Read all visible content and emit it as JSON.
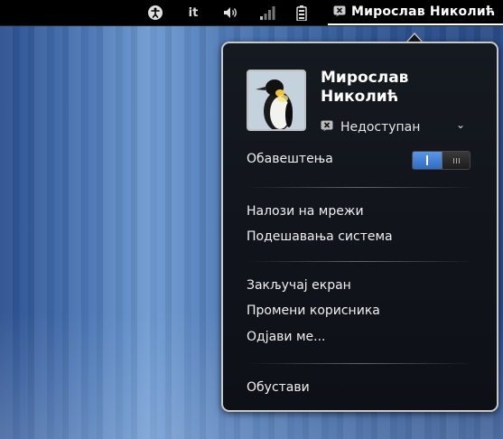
{
  "topbar": {
    "icons": [
      "accessibility-icon",
      "keyboard-layout-indicator",
      "volume-icon",
      "network-signal-icon",
      "battery-icon"
    ],
    "keyboard_layout": "it",
    "user_name": "Мирослав Николић",
    "status_icon": "unavailable-status-icon"
  },
  "menu": {
    "user_fullname": "Мирослав Николић",
    "status_label": "Недоступан",
    "notifications_label": "Обавештења",
    "notifications_enabled": true,
    "items": {
      "online_accounts": "Налози на мрежи",
      "system_settings": "Подешавања система",
      "lock_screen": "Закључај екран",
      "switch_user": "Промени корисника",
      "log_out": "Одјави ме...",
      "suspend": "Обустави"
    }
  },
  "colors": {
    "accent_blue": "#3b7ad6",
    "menu_bg": "#12161c",
    "menu_border": "#c8c8c8"
  }
}
